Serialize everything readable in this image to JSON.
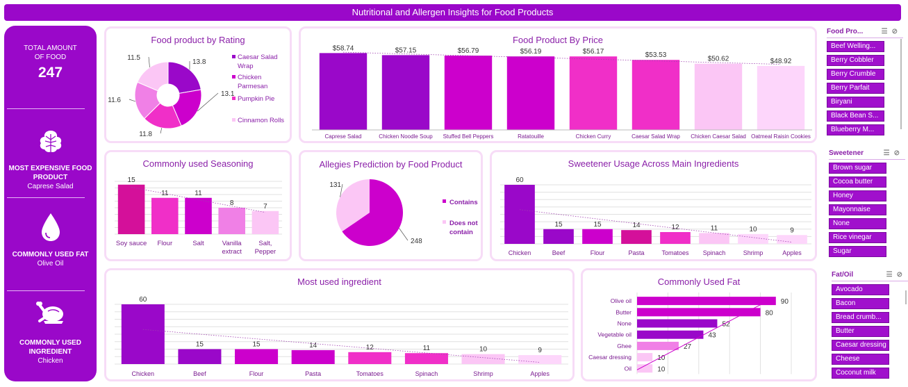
{
  "header": {
    "title": "Nutritional and Allergen Insights for Food Products"
  },
  "kpi": {
    "total_label": "TOTAL AMOUNT OF FOOD",
    "total_value": "247",
    "expensive_label": "MOST EXPENSIVE FOOD PRODUCT",
    "expensive_value": "Caprese Salad",
    "fat_label": "COMMONLY USED FAT",
    "fat_value": "Olive Oil",
    "ingredient_label": "COMMONLY USED INGREDIENT",
    "ingredient_value": "Chicken",
    "icons": [
      "lettuce-icon",
      "oil-drop-icon",
      "roast-chicken-icon"
    ]
  },
  "slicers": {
    "food_product": {
      "title": "Food Pro...",
      "items": [
        "Beef Welling...",
        "Berry Cobbler",
        "Berry Crumble",
        "Berry Parfait",
        "Biryani",
        "Black Bean S...",
        "Blueberry M..."
      ]
    },
    "sweetener": {
      "title": "Sweetener",
      "items": [
        "Brown sugar",
        "Cocoa butter",
        "Honey",
        "Mayonnaise",
        "None",
        "Rice vinegar",
        "Sugar"
      ]
    },
    "fat_oil": {
      "title": "Fat/Oil",
      "items": [
        "Avocado",
        "Bacon",
        "Bread crumb...",
        "Butter",
        "Caesar dressing",
        "Cheese",
        "Coconut milk"
      ]
    }
  },
  "colors": {
    "purple": "#9a08c9",
    "magenta": "#cc00cc",
    "deep_pink": "#d4109a",
    "pink": "#f02fc8",
    "mid_pink": "#f080e6",
    "light_pink": "#fbc6f5",
    "pale_pink": "#fdd6fb"
  },
  "chart_data": [
    {
      "id": "rating",
      "type": "pie",
      "variant": "donut",
      "title": "Food product by Rating",
      "categories": [
        "Caesar Salad Wrap",
        "Chicken Parmesan",
        "Pumpkin Pie",
        "Cinnamon Rolls"
      ],
      "legend": [
        "Caesar Salad Wrap",
        "Chicken Parmesan",
        "Pumpkin Pie",
        "Cinnamon Rolls"
      ],
      "values": [
        13.8,
        13.1,
        11.8,
        11.6,
        11.5
      ],
      "labels": [
        "13.8",
        "13.1",
        "11.8",
        "11.6",
        "11.5"
      ],
      "legend_position": "right"
    },
    {
      "id": "price",
      "type": "bar",
      "title": "Food Product By Price",
      "categories": [
        "Caprese Salad",
        "Chicken Noodle Soup",
        "Stuffed Bell Peppers",
        "Ratatouille",
        "Chicken Curry",
        "Caesar Salad Wrap",
        "Chicken Caesar Salad",
        "Oatmeal Raisin Cookies"
      ],
      "values": [
        58.74,
        57.15,
        56.79,
        56.19,
        56.17,
        53.53,
        50.62,
        48.92
      ],
      "labels": [
        "$58.74",
        "$57.15",
        "$56.79",
        "$56.19",
        "$56.17",
        "$53.53",
        "$50.62",
        "$48.92"
      ],
      "trendline": true
    },
    {
      "id": "seasoning",
      "type": "bar",
      "title": "Commonly used Seasoning",
      "categories": [
        "Soy sauce",
        "Flour",
        "Salt",
        "Vanilla extract",
        "Salt, Pepper"
      ],
      "category_lines": [
        [
          "Soy sauce"
        ],
        [
          "Flour"
        ],
        [
          "Salt"
        ],
        [
          "Vanilla",
          "extract"
        ],
        [
          "Salt,",
          "Pepper"
        ]
      ],
      "values": [
        15,
        11,
        11,
        8,
        7
      ],
      "trendline": true,
      "grid": true
    },
    {
      "id": "allergy",
      "type": "pie",
      "title": "Allegies Prediction by Food Product",
      "categories": [
        "Contains",
        "Does not contain"
      ],
      "legend_lines": [
        [
          "Contains"
        ],
        [
          "Does not",
          "contain"
        ]
      ],
      "values": [
        248,
        131
      ],
      "legend_position": "right"
    },
    {
      "id": "sweetener",
      "type": "bar",
      "title": "Sweetener Usage Across Main Ingredients",
      "categories": [
        "Chicken",
        "Beef",
        "Flour",
        "Pasta",
        "Tomatoes",
        "Spinach",
        "Shrimp",
        "Apples"
      ],
      "values": [
        60,
        15,
        15,
        14,
        12,
        11,
        10,
        9
      ],
      "trendline": true,
      "grid": true
    },
    {
      "id": "ingredient",
      "type": "bar",
      "title": "Most used ingredient",
      "categories": [
        "Chicken",
        "Beef",
        "Flour",
        "Pasta",
        "Tomatoes",
        "Spinach",
        "Shrimp",
        "Apples"
      ],
      "values": [
        60,
        15,
        15,
        14,
        12,
        11,
        10,
        9
      ],
      "trendline": true,
      "grid": true
    },
    {
      "id": "fat",
      "type": "bar",
      "orientation": "horizontal",
      "title": "Commonly Used Fat",
      "categories": [
        "Olive oil",
        "Butter",
        "None",
        "Vegetable oil",
        "Ghee",
        "Caesar dressing",
        "Oil"
      ],
      "values": [
        90,
        80,
        52,
        43,
        27,
        10,
        10
      ],
      "trendline": true,
      "grid": true
    }
  ]
}
